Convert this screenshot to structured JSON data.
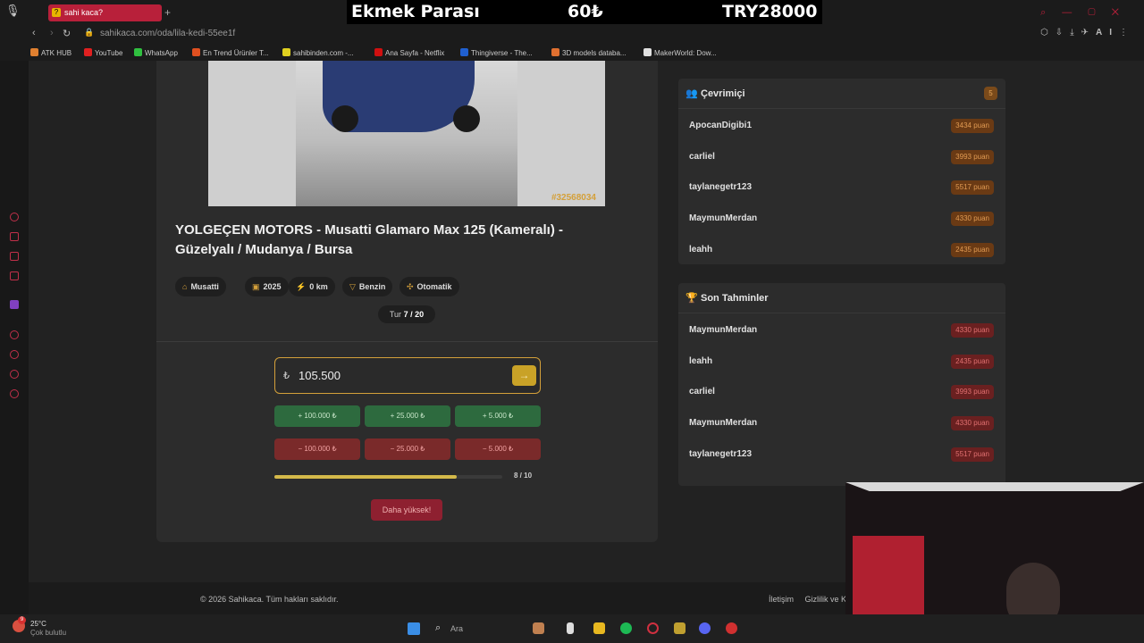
{
  "browser": {
    "tab_title": "sahi kaca?",
    "tab_favicon": "?",
    "new_tab": "+",
    "url": "sahikaca.com/oda/lila-kedi-55ee1f",
    "address_right": "AI",
    "bookmarks": [
      {
        "label": "ATK HUB",
        "color": "#e08030"
      },
      {
        "label": "YouTube",
        "color": "#e02020"
      },
      {
        "label": "WhatsApp",
        "color": "#30c040"
      },
      {
        "label": "En Trend Ürünler T...",
        "color": "#e05020"
      },
      {
        "label": "sahibinden.com -...",
        "color": "#e0d020"
      },
      {
        "label": "Ana Sayfa - Netflix",
        "color": "#d01010"
      },
      {
        "label": "Thingiverse - The...",
        "color": "#2060d0"
      },
      {
        "label": "3D models databa...",
        "color": "#e07030"
      },
      {
        "label": "MakerWorld: Dow...",
        "color": "#e0e0e0"
      }
    ]
  },
  "stream_overlay": {
    "label": "Ekmek Parası",
    "price": "60₺",
    "total": "TRY28000"
  },
  "listing": {
    "image_id": "#32568034",
    "title": "YOLGEÇEN MOTORS - Musatti Glamaro Max 125 (Kameralı) - Güzelyalı / Mudanya / Bursa",
    "tags": [
      {
        "icon": "⌂",
        "label": "Musatti"
      },
      {
        "icon": "▣",
        "label": "2025"
      },
      {
        "icon": "⚡",
        "label": "0 km"
      },
      {
        "icon": "▽",
        "label": "Benzin"
      },
      {
        "icon": "✣",
        "label": "Otomatik"
      }
    ],
    "round_label": "Tur",
    "round_value": "7 / 20"
  },
  "guess": {
    "currency": "₺",
    "value": "105.500",
    "submit_icon": "→",
    "plus_buttons": [
      "+ 100.000 ₺",
      "+ 25.000 ₺",
      "+ 5.000 ₺"
    ],
    "minus_buttons": [
      "− 100.000 ₺",
      "− 25.000 ₺",
      "− 5.000 ₺"
    ],
    "progress_fraction": 0.8,
    "progress_text": "8 / 10",
    "hint": "Daha yüksek!"
  },
  "online": {
    "title": "Çevrimiçi",
    "count": "5",
    "users": [
      {
        "name": "ApocanDigibi1",
        "score": "3434 puan"
      },
      {
        "name": "carliel",
        "score": "3993 puan"
      },
      {
        "name": "taylanegetr123",
        "score": "5517 puan"
      },
      {
        "name": "MaymunMerdan",
        "score": "4330 puan"
      },
      {
        "name": "leahh",
        "score": "2435 puan"
      }
    ]
  },
  "recent": {
    "title": "Son Tahminler",
    "guesses": [
      {
        "name": "MaymunMerdan",
        "score": "4330 puan"
      },
      {
        "name": "leahh",
        "score": "2435 puan"
      },
      {
        "name": "carliel",
        "score": "3993 puan"
      },
      {
        "name": "MaymunMerdan",
        "score": "4330 puan"
      },
      {
        "name": "taylanegetr123",
        "score": "5517 puan"
      }
    ]
  },
  "footer": {
    "copyright": "© 2026 Sahikaca. Tüm hakları saklıdır.",
    "contact": "İletişim",
    "privacy": "Gizlilik ve K"
  },
  "taskbar": {
    "weather_temp": "25°C",
    "weather_desc": "Çok bulutlu",
    "notif_count": "9",
    "search_placeholder": "Ara"
  },
  "colors": {
    "accent": "#d4a03a",
    "plus": "#2d6a3e",
    "minus": "#7a2a2a",
    "tab": "#b8203a"
  }
}
